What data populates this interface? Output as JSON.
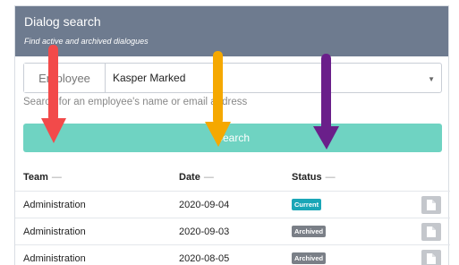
{
  "panel": {
    "title": "Dialog search",
    "subtitle": "Find active and archived dialogues"
  },
  "search": {
    "addon_label": "Employee",
    "selected_value": "Kasper Marked",
    "helper_text": "Search for an employee's name or email address",
    "button_label": "Search"
  },
  "table": {
    "columns": [
      {
        "label": "Team",
        "sort": "—"
      },
      {
        "label": "Date",
        "sort": "—"
      },
      {
        "label": "Status",
        "sort": "—"
      }
    ],
    "rows": [
      {
        "team": "Administration",
        "date": "2020-09-04",
        "status": "Current",
        "status_color": "#1aa6b7"
      },
      {
        "team": "Administration",
        "date": "2020-09-03",
        "status": "Archived",
        "status_color": "#7a7f87"
      },
      {
        "team": "Administration",
        "date": "2020-08-05",
        "status": "Archived",
        "status_color": "#7a7f87"
      }
    ]
  },
  "colors": {
    "header_bg": "#6e7b8f",
    "button_bg": "#6fd3c2",
    "arrow_red": "#f24a4a",
    "arrow_orange": "#f5a800",
    "arrow_purple": "#6a1f8a"
  }
}
